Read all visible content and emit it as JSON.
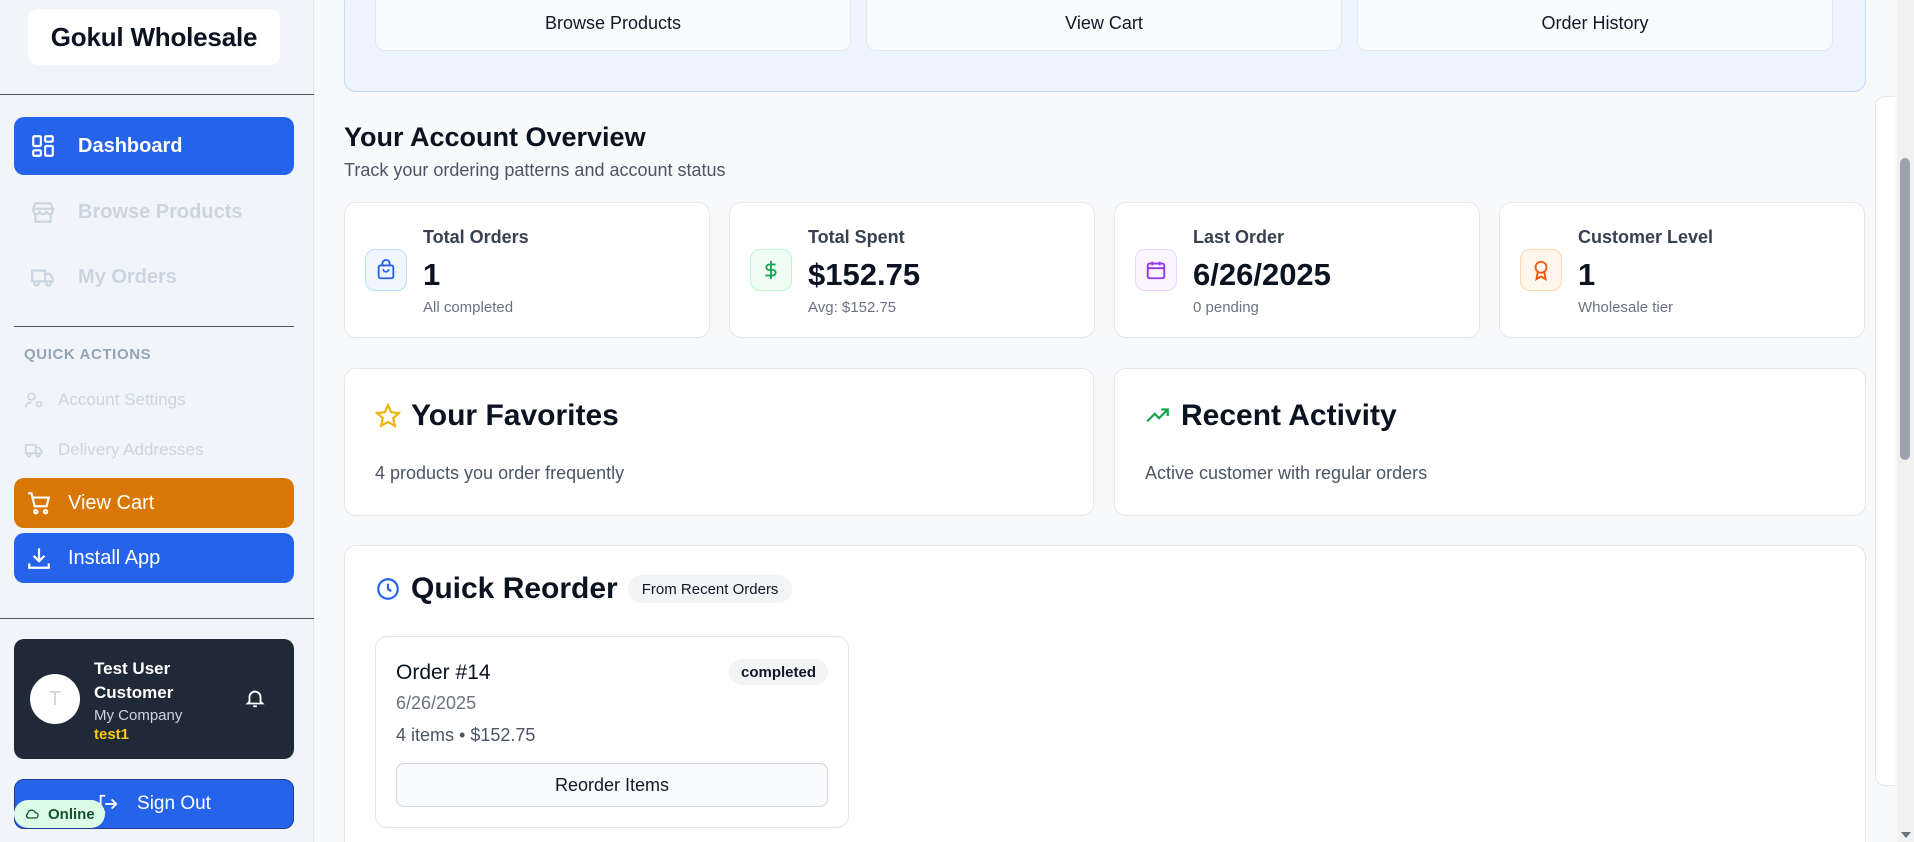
{
  "brand": {
    "name": "Gokul Wholesale"
  },
  "sidebar": {
    "nav": [
      {
        "label": "Dashboard",
        "icon": "grid-icon",
        "active": true
      },
      {
        "label": "Browse Products",
        "icon": "store-icon",
        "active": false
      },
      {
        "label": "My Orders",
        "icon": "truck-icon",
        "active": false
      }
    ],
    "quick_actions_label": "QUICK ACTIONS",
    "quick_links": [
      {
        "label": "Account Settings",
        "icon": "user-cog-icon"
      },
      {
        "label": "Delivery Addresses",
        "icon": "truck-icon"
      }
    ],
    "view_cart": "View Cart",
    "install_app": "Install App"
  },
  "user": {
    "initial": "T",
    "name": "Test User Customer",
    "company": "My Company",
    "handle": "test1"
  },
  "signout": "Sign Out",
  "status": {
    "online": "Online"
  },
  "top_actions": [
    "Browse Products",
    "View Cart",
    "Order History"
  ],
  "overview": {
    "title": "Your Account Overview",
    "subtitle": "Track your ordering patterns and account status",
    "stats": [
      {
        "label": "Total Orders",
        "value": "1",
        "note": "All completed",
        "icon": "bag-icon",
        "color": "#2563eb"
      },
      {
        "label": "Total Spent",
        "value": "$152.75",
        "note": "Avg: $152.75",
        "icon": "dollar-icon",
        "color": "#16a34a"
      },
      {
        "label": "Last Order",
        "value": "6/26/2025",
        "note": "0 pending",
        "icon": "calendar-icon",
        "color": "#9333ea"
      },
      {
        "label": "Customer Level",
        "value": "1",
        "note": "Wholesale tier",
        "icon": "award-icon",
        "color": "#ea580c"
      }
    ]
  },
  "favorites": {
    "title": "Your Favorites",
    "text": "4 products you order frequently"
  },
  "activity": {
    "title": "Recent Activity",
    "text": "Active customer with regular orders"
  },
  "reorder": {
    "title": "Quick Reorder",
    "badge": "From Recent Orders",
    "order": {
      "title": "Order #14",
      "date": "6/26/2025",
      "summary": "4 items • $152.75",
      "status": "completed",
      "button": "Reorder Items"
    }
  }
}
